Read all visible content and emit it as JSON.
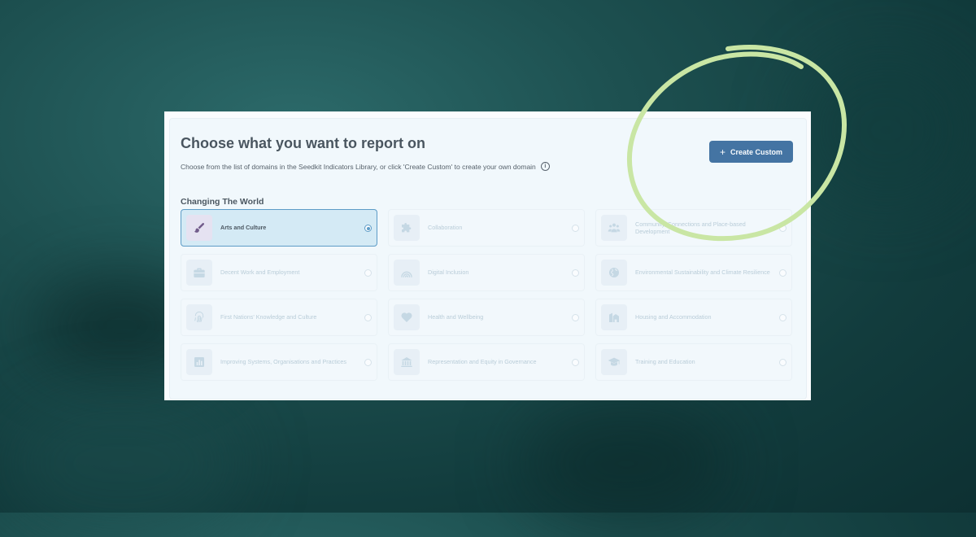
{
  "page": {
    "title": "Choose what you want to report on",
    "subtitle": "Choose from the list of domains in the Seedkit Indicators Library, or click 'Create Custom' to create your own domain",
    "create_button_label": "Create Custom",
    "section_title": "Changing The World"
  },
  "domains": [
    {
      "label": "Arts and Culture",
      "icon": "paintbrush-icon",
      "selected": true
    },
    {
      "label": "Collaboration",
      "icon": "puzzle-icon",
      "selected": false
    },
    {
      "label": "Community, Connections and Place-based Development",
      "icon": "people-icon",
      "selected": false
    },
    {
      "label": "Decent Work and Employment",
      "icon": "briefcase-icon",
      "selected": false
    },
    {
      "label": "Digital Inclusion",
      "icon": "wifi-icon",
      "selected": false
    },
    {
      "label": "Environmental Sustainability and Climate Resilience",
      "icon": "globe-icon",
      "selected": false
    },
    {
      "label": "First Nations' Knowledge and Culture",
      "icon": "fingerprint-icon",
      "selected": false
    },
    {
      "label": "Health and Wellbeing",
      "icon": "heart-icon",
      "selected": false
    },
    {
      "label": "Housing and Accommodation",
      "icon": "house-icon",
      "selected": false
    },
    {
      "label": "Improving Systems, Organisations and Practices",
      "icon": "bar-chart-icon",
      "selected": false
    },
    {
      "label": "Representation and Equity in Governance",
      "icon": "bank-icon",
      "selected": false
    },
    {
      "label": "Training and Education",
      "icon": "graduation-cap-icon",
      "selected": false
    }
  ],
  "colors": {
    "primary_button": "#0c4a86",
    "selected_border": "#2e7fb6",
    "selected_bg": "#cde7f3",
    "annotation_circle": "#c9e6a4",
    "background": "#1d5050"
  }
}
